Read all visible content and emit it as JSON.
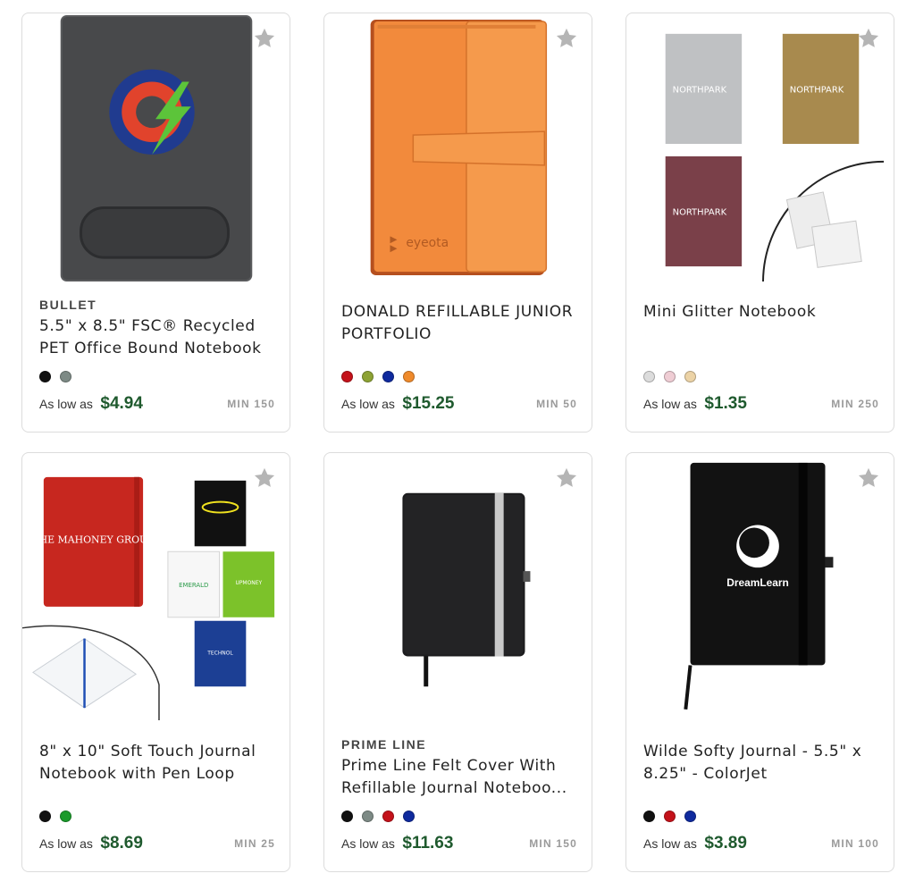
{
  "colors": {
    "price": "#1f5a2e",
    "border": "#dcdcdc",
    "star": "#b5b5b5"
  },
  "products": [
    {
      "brand": "BULLET",
      "title": "5.5\" x 8.5\" FSC® Recycled PET Office Bound Notebook",
      "price_prefix": "As low as",
      "price": "$4.94",
      "min": "MIN 150",
      "swatches": [
        "#111111",
        "#7d8a85"
      ],
      "image": "gray-notebook-logo",
      "favorite_icon": "star-icon"
    },
    {
      "brand": "",
      "title": "DONALD REFILLABLE JUNIOR PORTFOLIO",
      "price_prefix": "As low as",
      "price": "$15.25",
      "min": "MIN 50",
      "swatches": [
        "#c4121a",
        "#8da234",
        "#0f2a9e",
        "#ef8a2b"
      ],
      "image": "orange-portfolio",
      "image_text": "eyeota",
      "favorite_icon": "star-icon"
    },
    {
      "brand": "",
      "title": "Mini Glitter Notebook",
      "price_prefix": "As low as",
      "price": "$1.35",
      "min": "MIN 250",
      "swatches": [
        "#dcdcdc",
        "#efcdd4",
        "#ecd3a6"
      ],
      "image": "glitter-notebooks",
      "image_text": "NORTHPARK",
      "favorite_icon": "star-icon"
    },
    {
      "brand": "",
      "title": "8\" x 10\" Soft Touch Journal Notebook with Pen Loop",
      "price_prefix": "As low as",
      "price": "$8.69",
      "min": "MIN 25",
      "swatches": [
        "#111111",
        "#1a9a2a"
      ],
      "image": "soft-touch-journals",
      "image_texts": [
        "THE MAHONEY GROUP",
        "EMERALD",
        "UPMONEY",
        "TECHNOL"
      ],
      "favorite_icon": "star-icon"
    },
    {
      "brand": "PRIME LINE",
      "title": "Prime Line Felt Cover With Refillable Journal Noteboo...",
      "price_prefix": "As low as",
      "price": "$11.63",
      "min": "MIN 150",
      "swatches": [
        "#111111",
        "#7d8a85",
        "#c4121a",
        "#0f2a9e"
      ],
      "image": "black-felt-journal",
      "favorite_icon": "star-icon"
    },
    {
      "brand": "",
      "title": "Wilde Softy Journal - 5.5\" x 8.25\" - ColorJet",
      "price_prefix": "As low as",
      "price": "$3.89",
      "min": "MIN 100",
      "swatches": [
        "#111111",
        "#c4121a",
        "#0f2a9e"
      ],
      "image": "black-softy-journal",
      "image_text": "DreamLearn",
      "favorite_icon": "star-icon"
    }
  ]
}
